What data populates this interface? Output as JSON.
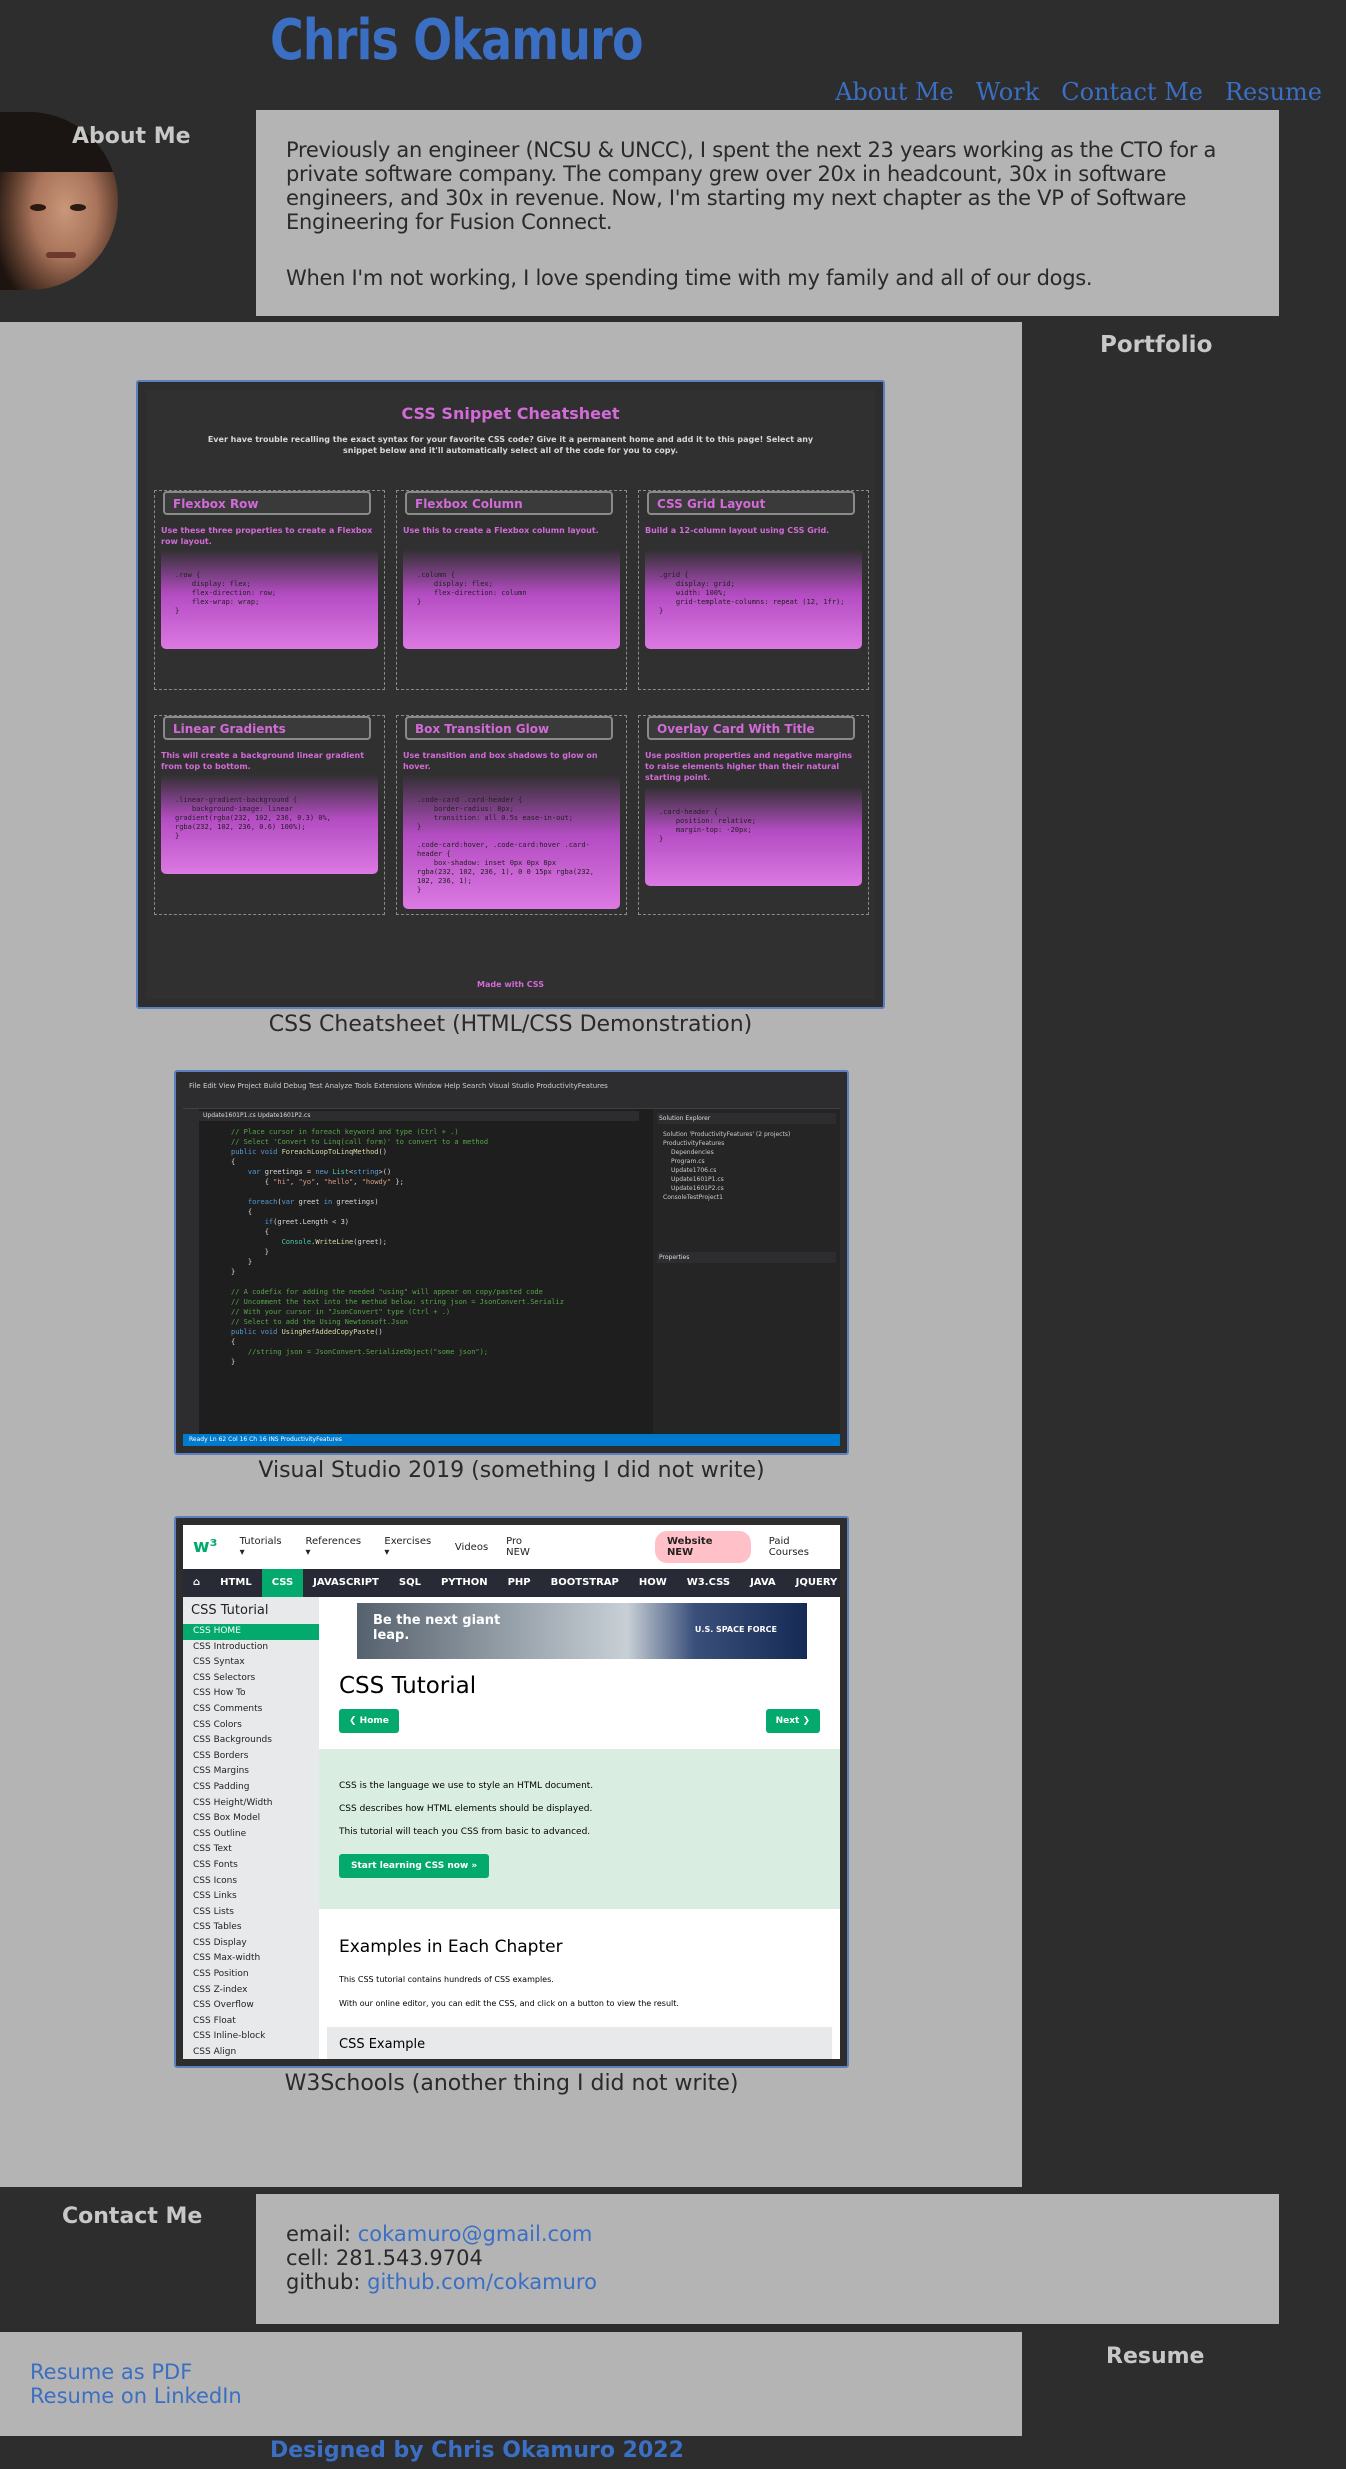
{
  "header": {
    "title": "Chris Okamuro",
    "nav": [
      "About Me",
      "Work",
      "Contact Me",
      "Resume"
    ]
  },
  "about": {
    "heading": "About Me",
    "p1": "Previously an engineer (NCSU & UNCC), I spent the next 23 years working as the CTO for a private software company. The company grew over 20x in headcount, 30x in software engineers, and 30x in revenue. Now, I'm starting my next chapter as the VP of Software Engineering for Fusion Connect.",
    "p2": "When I'm not working, I love spending time with my family and all of our dogs."
  },
  "portfolio": {
    "heading": "Portfolio",
    "items": [
      {
        "caption": "CSS Cheatsheet (HTML/CSS Demonstration)",
        "title": "CSS Snippet Cheatsheet",
        "subtitle": "Ever have trouble recalling the exact syntax for your favorite CSS code? Give it a permanent home and add it to this page! Select any snippet below and it'll automatically select all of the code for you to copy.",
        "cards": [
          {
            "label": "Flexbox Row",
            "desc": "Use these three properties to create a Flexbox row layout.",
            "code": ".row {\n    display: flex;\n    flex-direction: row;\n    flex-wrap: wrap;\n}"
          },
          {
            "label": "Flexbox Column",
            "desc": "Use this to create a Flexbox column layout.",
            "code": ".column {\n    display: flex;\n    flex-direction: column\n}"
          },
          {
            "label": "CSS Grid Layout",
            "desc": "Build a 12-column layout using CSS Grid.",
            "code": ".grid {\n    display: grid;\n    width: 100%;\n    grid-template-columns: repeat (12, 1fr);\n}"
          },
          {
            "label": "Linear Gradients",
            "desc": "This will create a background linear gradient from top to bottom.",
            "code": ".linear-gradient-background {\n    background-image: linear\ngradient(rgba(232, 102, 236, 0.3) 0%,\nrgba(232, 102, 236, 0.6) 100%);\n}"
          },
          {
            "label": "Box Transition Glow",
            "desc": "Use transition and box shadows to glow on hover.",
            "code": ".code-card .card-header {\n    border-radius: 8px;\n    transition: all 0.5s ease-in-out;\n}\n\n.code-card:hover, .code-card:hover .card-\nheader {\n    box-shadow: inset 0px 0px 8px\nrgba(232, 102, 236, 1), 0 0 15px rgba(232,\n102, 236, 1);\n}"
          },
          {
            "label": "Overlay Card With Title",
            "desc": "Use position properties and negative margins to raise elements higher than their natural starting point.",
            "code": ".card-header {\n    position: relative;\n    margin-top: -20px;\n}"
          }
        ],
        "footer": "Made with CSS"
      },
      {
        "caption": "Visual Studio 2019 (something I did not write)",
        "menu": "File  Edit  View  Project  Build  Debug  Test  Analyze  Tools  Extensions  Window  Help     Search Visual Studio      ProductivityFeatures",
        "tabs": "Update1601P1.cs   Update1601P2.cs",
        "solution_header": "Solution Explorer",
        "solution_items": [
          "Solution 'ProductivityFeatures' (2 projects)",
          "ProductivityFeatures",
          "Dependencies",
          "Program.cs",
          "Update1706.cs",
          "Update1601P1.cs",
          "Update1601P2.cs",
          "ConsoleTestProject1"
        ],
        "properties_header": "Properties",
        "status": "Ready                                             Ln 62     Col 16     Ch 16        INS          ProductivityFeatures"
      },
      {
        "caption": "W3Schools (another thing I did not write)",
        "top": [
          "Tutorials ▾",
          "References ▾",
          "Exercises ▾",
          "Videos",
          "Pro NEW"
        ],
        "website_btn": "Website NEW",
        "paid": "Paid Courses",
        "nav": [
          "⌂",
          "HTML",
          "CSS",
          "JAVASCRIPT",
          "SQL",
          "PYTHON",
          "PHP",
          "BOOTSTRAP",
          "HOW TO",
          "W3.CSS",
          "JAVA",
          "JQUERY"
        ],
        "side_heading": "CSS Tutorial",
        "side_items": [
          "CSS HOME",
          "CSS Introduction",
          "CSS Syntax",
          "CSS Selectors",
          "CSS How To",
          "CSS Comments",
          "CSS Colors",
          "CSS Backgrounds",
          "CSS Borders",
          "CSS Margins",
          "CSS Padding",
          "CSS Height/Width",
          "CSS Box Model",
          "CSS Outline",
          "CSS Text",
          "CSS Fonts",
          "CSS Icons",
          "CSS Links",
          "CSS Lists",
          "CSS Tables",
          "CSS Display",
          "CSS Max-width",
          "CSS Position",
          "CSS Z-index",
          "CSS Overflow",
          "CSS Float",
          "CSS Inline-block",
          "CSS Align"
        ],
        "ad_text": "Be the next giant leap.",
        "ad_brand": "U.S. SPACE FORCE",
        "h1": "CSS Tutorial",
        "home_btn": "❮ Home",
        "next_btn": "Next ❯",
        "intro": [
          "CSS is the language we use to style an HTML document.",
          "CSS describes how HTML elements should be displayed.",
          "This tutorial will teach you CSS from basic to advanced."
        ],
        "start_btn": "Start learning CSS now »",
        "h2": "Examples in Each Chapter",
        "p1": "This CSS tutorial contains hundreds of CSS examples.",
        "p2": "With our online editor, you can edit the CSS, and click on a button to view the result.",
        "example": "CSS Example"
      }
    ]
  },
  "contact": {
    "heading": "Contact Me",
    "email_label": "email:",
    "email": "cokamuro@gmail.com",
    "cell_label": "cell:",
    "cell": "281.543.9704",
    "github_label": "github:",
    "github": "github.com/cokamuro"
  },
  "resume": {
    "heading": "Resume",
    "pdf": "Resume as PDF",
    "linkedin": "Resume on LinkedIn"
  },
  "footer": "Designed by Chris Okamuro 2022",
  "colors": {
    "accent": "#3b6fc4",
    "panel": "#b4b4b4",
    "background": "#2d2d2d"
  }
}
